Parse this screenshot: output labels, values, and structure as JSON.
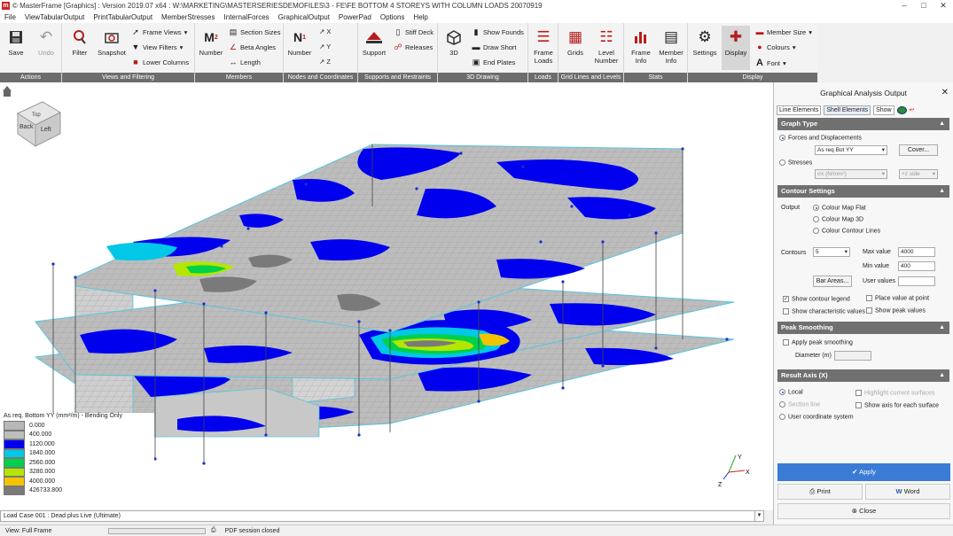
{
  "window": {
    "title": "© MasterFrame [Graphics] : Version 2019.07 x64 : W:\\MARKETING\\MASTERSERIESDEMOFILES\\3 - FE\\FE BOTTOM 4 STOREYS WITH COLUMN LOADS 20070919"
  },
  "menu": [
    "File",
    "ViewTabularOutput",
    "PrintTabularOutput",
    "MemberStresses",
    "InternalForces",
    "GraphicalOutput",
    "PowerPad",
    "Options",
    "Help"
  ],
  "ribbon": {
    "save": "Save",
    "undo": "Undo",
    "filter": "Filter",
    "snapshot": "Snapshot",
    "frame_views": "Frame Views",
    "view_filters": "View Filters",
    "lower_columns": "Lower Columns",
    "member_number": "Number",
    "section_sizes": "Section Sizes",
    "beta_angles": "Beta Angles",
    "length": "Length",
    "node_number": "Number",
    "support": "Support",
    "stiff_deck": "Stiff Deck",
    "releases": "Releases",
    "three_d": "3D",
    "show_founds": "Show Founds",
    "draw_short": "Draw Short",
    "end_plates": "End Plates",
    "frame_loads": "Frame Loads",
    "grids": "Grids",
    "level_number": "Level Number",
    "frame_info": "Frame Info",
    "member_info": "Member Info",
    "settings": "Settings",
    "display": "Display",
    "member_size": "Member Size",
    "colours": "Colours",
    "font": "Font",
    "groups": [
      "Actions",
      "Views and Filtering",
      "Members",
      "Nodes and Coordinates",
      "Supports and Restraints",
      "3D Drawing",
      "Loads",
      "Grid Lines and Levels",
      "Stats",
      "Display"
    ]
  },
  "navcube": {
    "top": "Top",
    "front": "Back",
    "side": "Left"
  },
  "legend": {
    "title": "As req. Bottom YY (mm²/m) - Bending Only",
    "rows": [
      {
        "label": "0.000",
        "color": "#b8b8b8"
      },
      {
        "label": "400.000",
        "color": "#bdbdbd"
      },
      {
        "label": "1120.000",
        "color": "#0000ee"
      },
      {
        "label": "1840.000",
        "color": "#00c8e6"
      },
      {
        "label": "2560.000",
        "color": "#00d04a"
      },
      {
        "label": "3280.000",
        "color": "#b4e600"
      },
      {
        "label": "4000.000",
        "color": "#f2c400"
      },
      {
        "label": "426733.800",
        "color": "#7a7a7a"
      }
    ]
  },
  "axis": {
    "x": "X",
    "y": "Y",
    "z": "Z"
  },
  "loadcase": "Load Case 001 : Dead plus Live (Ultimate)",
  "status": {
    "view": "View: Full Frame",
    "pdf": "PDF session closed"
  },
  "panel": {
    "title": "Graphical Analysis Output",
    "tab_line": "Line Elements",
    "tab_shell": "Shell Elements",
    "show": "Show",
    "graph_type": "Graph Type",
    "forces": "Forces and Displacements",
    "forces_value": "As req Bot YY",
    "cover": "Cover...",
    "stresses": "Stresses",
    "stress_value": "σx (N/mm²)",
    "side_value": "+z side",
    "contour_settings": "Contour Settings",
    "output": "Output",
    "cm_flat": "Colour Map Flat",
    "cm_3d": "Colour Map 3D",
    "contour_lines": "Colour Contour Lines",
    "contours": "Contours",
    "contours_value": "5",
    "max_label": "Max value",
    "max_value": "4000",
    "min_label": "Min value",
    "min_value": "400",
    "bar_areas": "Bar Areas...",
    "user_values": "User values",
    "show_legend": "Show contour legend",
    "place_value": "Place value at point",
    "show_char": "Show characteristic values",
    "show_peak": "Show peak values",
    "peak_smoothing": "Peak Smoothing",
    "apply_peak": "Apply peak smoothing",
    "diameter": "Diameter (m)",
    "result_axis": "Result Axis (X)",
    "local": "Local",
    "section_line": "Section line",
    "user_coord": "User coordinate system",
    "highlight": "Highlight current surfaces",
    "show_axis": "Show axis for each surface",
    "apply": "Apply",
    "print": "Print",
    "word": "Word",
    "close": "Close"
  }
}
